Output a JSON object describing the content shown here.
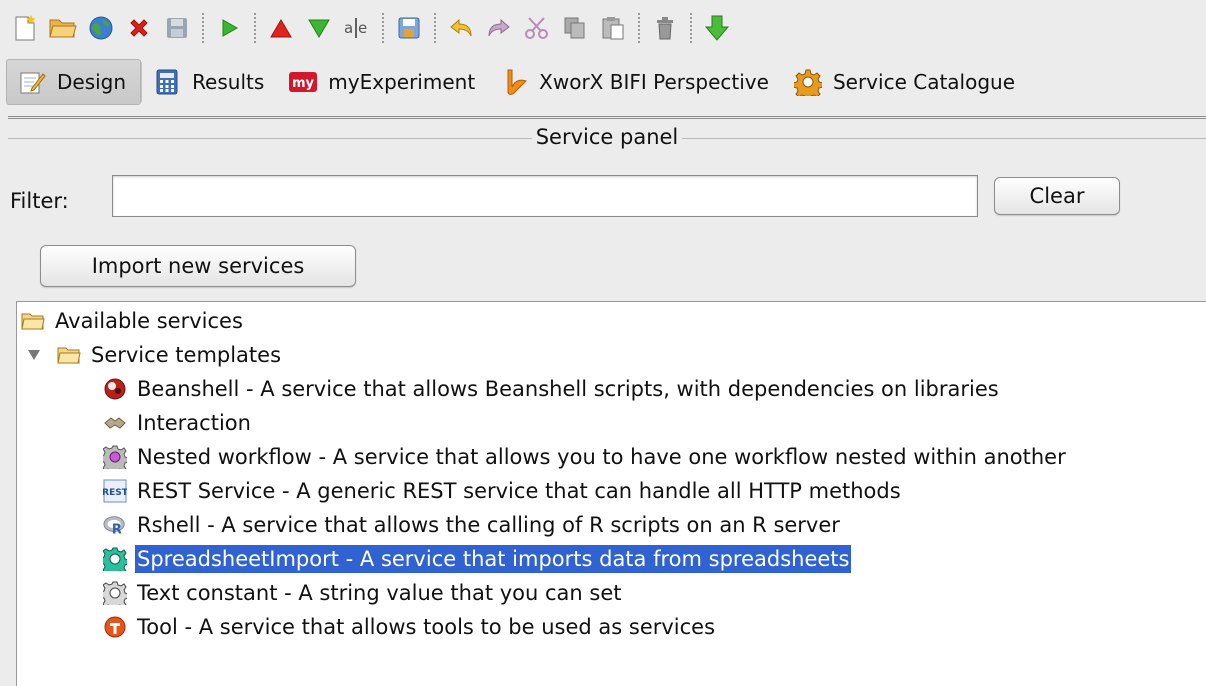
{
  "toolbar": {
    "icons": [
      "new-workflow-icon",
      "open-folder-icon",
      "globe-icon",
      "close-red-x-icon",
      "save-icon",
      "run-icon",
      "move-up-icon",
      "move-down-icon",
      "rename-icon",
      "save-as-icon",
      "undo-icon",
      "redo-icon",
      "cut-icon",
      "copy-icon",
      "paste-icon",
      "delete-icon",
      "download-icon"
    ]
  },
  "perspectives": [
    {
      "label": "Design",
      "icon": "design-icon",
      "selected": true
    },
    {
      "label": "Results",
      "icon": "calculator-icon",
      "selected": false
    },
    {
      "label": "myExperiment",
      "icon": "myexperiment-icon",
      "selected": false
    },
    {
      "label": "XworX BIFI Perspective",
      "icon": "xworx-icon",
      "selected": false
    },
    {
      "label": "Service Catalogue",
      "icon": "catalogue-gear-icon",
      "selected": false
    }
  ],
  "panel": {
    "title": "Service panel",
    "filter_label": "Filter:",
    "filter_value": "",
    "clear_label": "Clear",
    "import_label": "Import new services"
  },
  "tree": {
    "root": "Available services",
    "group": "Service templates",
    "items": [
      {
        "label": "Beanshell - A service that allows Beanshell scripts, with dependencies on libraries",
        "icon": "beanshell-icon",
        "selected": false
      },
      {
        "label": "Interaction",
        "icon": "interaction-icon",
        "selected": false
      },
      {
        "label": "Nested workflow - A service that allows you to have one workflow nested within another",
        "icon": "nested-workflow-gear-icon",
        "selected": false
      },
      {
        "label": "REST Service - A generic REST service that can handle all HTTP methods",
        "icon": "rest-icon",
        "selected": false
      },
      {
        "label": "Rshell - A service that allows the calling of R scripts on an R server",
        "icon": "r-icon",
        "selected": false
      },
      {
        "label": "SpreadsheetImport - A service that imports data from spreadsheets",
        "icon": "spreadsheet-gear-icon",
        "selected": true
      },
      {
        "label": "Text constant - A string value that you can set",
        "icon": "text-constant-gear-icon",
        "selected": false
      },
      {
        "label": "Tool - A service that allows tools to be used as services",
        "icon": "tool-icon",
        "selected": false
      }
    ]
  },
  "colors": {
    "selection": "#3062d2",
    "background": "#ececec"
  }
}
